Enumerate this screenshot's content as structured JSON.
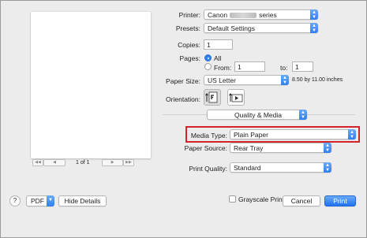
{
  "printer": {
    "label": "Printer:",
    "name_prefix": "Canon",
    "name_suffix": "series"
  },
  "presets": {
    "label": "Presets:",
    "value": "Default Settings"
  },
  "copies": {
    "label": "Copies:",
    "value": "1"
  },
  "pages": {
    "label": "Pages:",
    "all_label": "All",
    "from_label": "From:",
    "from_value": "1",
    "to_label": "to:",
    "to_value": "1"
  },
  "paper_size": {
    "label": "Paper Size:",
    "value": "US Letter",
    "dimensions": "8.50 by 11.00 inches"
  },
  "orientation": {
    "label": "Orientation:",
    "portrait_icon": "portrait-icon",
    "landscape_icon": "landscape-icon"
  },
  "section": {
    "value": "Quality & Media"
  },
  "media_type": {
    "label": "Media Type:",
    "value": "Plain Paper"
  },
  "paper_source": {
    "label": "Paper Source:",
    "value": "Rear Tray"
  },
  "print_quality": {
    "label": "Print Quality:",
    "value": "Standard"
  },
  "grayscale": {
    "label": "Grayscale Printing",
    "checked": false
  },
  "preview_nav": {
    "page_indicator": "1 of 1"
  },
  "footer": {
    "help": "?",
    "pdf": "PDF",
    "hide_details": "Hide Details",
    "cancel": "Cancel",
    "print": "Print"
  },
  "colors": {
    "accent": "#2f80f5",
    "highlight": "#d4232a"
  }
}
